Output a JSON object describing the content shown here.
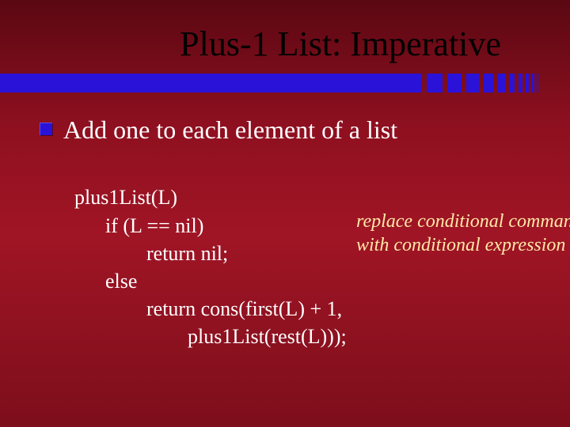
{
  "title": "Plus-1 List: Imperative",
  "bullet": "Add one to each element of a list",
  "code": {
    "l1": "plus1List(L)",
    "l2": "      if (L == nil)",
    "l3": "              return nil;",
    "l4": "      else",
    "l5": "              return cons(first(L) + 1,",
    "l6": "                      plus1List(rest(L)));"
  },
  "annotation": {
    "line1": "replace conditional command",
    "line2": "with conditional expression"
  },
  "icons": {
    "bullet": "square-bullet-icon"
  }
}
